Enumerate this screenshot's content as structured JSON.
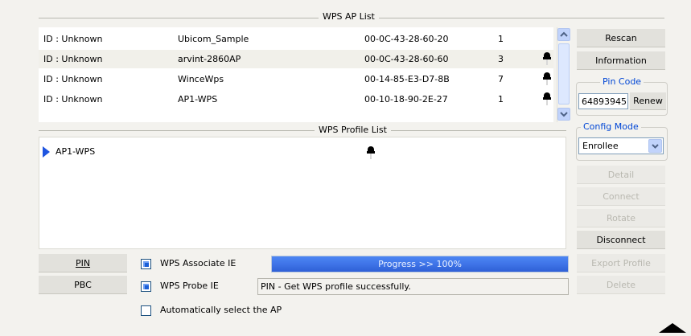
{
  "ap_list": {
    "title": "WPS AP List",
    "rows": [
      {
        "id": "ID : Unknown",
        "ssid": "Ubicom_Sample",
        "bssid": "00-0C-43-28-60-20",
        "channel": "1",
        "locked": false
      },
      {
        "id": "ID : Unknown",
        "ssid": "arvint-2860AP",
        "bssid": "00-0C-43-28-60-60",
        "channel": "3",
        "locked": true
      },
      {
        "id": "ID : Unknown",
        "ssid": "WinceWps",
        "bssid": "00-14-85-E3-D7-8B",
        "channel": "7",
        "locked": true
      },
      {
        "id": "ID : Unknown",
        "ssid": "AP1-WPS",
        "bssid": "00-10-18-90-2E-27",
        "channel": "1",
        "locked": true
      }
    ]
  },
  "profile_list": {
    "title": "WPS Profile List",
    "items": [
      {
        "name": "AP1-WPS",
        "locked": true
      }
    ]
  },
  "buttons": {
    "rescan": "Rescan",
    "information": "Information",
    "renew": "Renew",
    "detail": "Detail",
    "connect": "Connect",
    "rotate": "Rotate",
    "disconnect": "Disconnect",
    "export_profile": "Export Profile",
    "delete": "Delete",
    "pin": "PIN",
    "pbc": "PBC"
  },
  "pin_code": {
    "label": "Pin Code",
    "value": "64893945"
  },
  "config_mode": {
    "label": "Config Mode",
    "selected": "Enrollee"
  },
  "options": {
    "wps_associate_ie": {
      "label": "WPS Associate IE",
      "checked": true
    },
    "wps_probe_ie": {
      "label": "WPS Probe IE",
      "checked": true
    },
    "auto_select_ap": {
      "label": "Automatically select the AP",
      "checked": false
    }
  },
  "progress": {
    "text": "Progress >> 100%",
    "value": 100
  },
  "status_text": "PIN - Get WPS profile successfully.",
  "colors": {
    "accent": "#0046d5",
    "progress": "#3f74e8",
    "selection_arrow": "#1f55e0"
  }
}
